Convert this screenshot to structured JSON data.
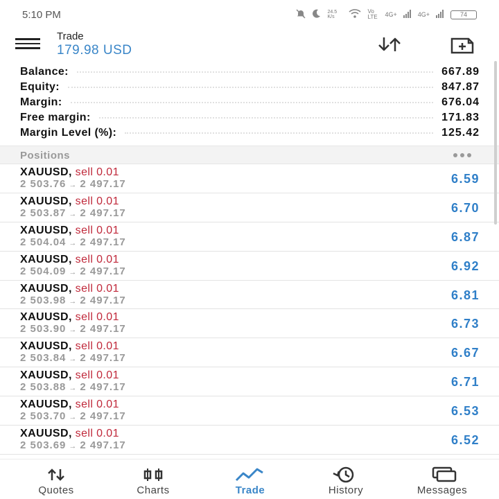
{
  "status_bar": {
    "time": "5:10 PM",
    "net_speed": "24.5 K/s",
    "sim1": "Vo LTE",
    "sim_signal_1": "4G+",
    "sim_signal_2": "4G+",
    "battery": "74"
  },
  "header": {
    "title": "Trade",
    "subtitle": "179.98 USD"
  },
  "summary": [
    {
      "label": "Balance:",
      "value": "667.89"
    },
    {
      "label": "Equity:",
      "value": "847.87"
    },
    {
      "label": "Margin:",
      "value": "676.04"
    },
    {
      "label": "Free margin:",
      "value": "171.83"
    },
    {
      "label": "Margin Level (%):",
      "value": "125.42"
    }
  ],
  "positions": {
    "title": "Positions",
    "items": [
      {
        "symbol": "XAUUSD,",
        "side": "sell 0.01",
        "open": "2 503.76",
        "arrow": "→",
        "current": "2 497.17",
        "profit": "6.59"
      },
      {
        "symbol": "XAUUSD,",
        "side": "sell 0.01",
        "open": "2 503.87",
        "arrow": "→",
        "current": "2 497.17",
        "profit": "6.70"
      },
      {
        "symbol": "XAUUSD,",
        "side": "sell 0.01",
        "open": "2 504.04",
        "arrow": "→",
        "current": "2 497.17",
        "profit": "6.87"
      },
      {
        "symbol": "XAUUSD,",
        "side": "sell 0.01",
        "open": "2 504.09",
        "arrow": "→",
        "current": "2 497.17",
        "profit": "6.92"
      },
      {
        "symbol": "XAUUSD,",
        "side": "sell 0.01",
        "open": "2 503.98",
        "arrow": "→",
        "current": "2 497.17",
        "profit": "6.81"
      },
      {
        "symbol": "XAUUSD,",
        "side": "sell 0.01",
        "open": "2 503.90",
        "arrow": "→",
        "current": "2 497.17",
        "profit": "6.73"
      },
      {
        "symbol": "XAUUSD,",
        "side": "sell 0.01",
        "open": "2 503.84",
        "arrow": "→",
        "current": "2 497.17",
        "profit": "6.67"
      },
      {
        "symbol": "XAUUSD,",
        "side": "sell 0.01",
        "open": "2 503.88",
        "arrow": "→",
        "current": "2 497.17",
        "profit": "6.71"
      },
      {
        "symbol": "XAUUSD,",
        "side": "sell 0.01",
        "open": "2 503.70",
        "arrow": "→",
        "current": "2 497.17",
        "profit": "6.53"
      },
      {
        "symbol": "XAUUSD,",
        "side": "sell 0.01",
        "open": "2 503.69",
        "arrow": "→",
        "current": "2 497.17",
        "profit": "6.52"
      }
    ]
  },
  "bottom_nav": [
    {
      "label": "Quotes",
      "icon": "quotes-icon"
    },
    {
      "label": "Charts",
      "icon": "charts-icon"
    },
    {
      "label": "Trade",
      "icon": "trade-icon",
      "active": true
    },
    {
      "label": "History",
      "icon": "history-icon"
    },
    {
      "label": "Messages",
      "icon": "messages-icon"
    }
  ],
  "colors": {
    "accent": "#3a86c8",
    "sell": "#c0283a",
    "profit": "#2f7fc8"
  }
}
